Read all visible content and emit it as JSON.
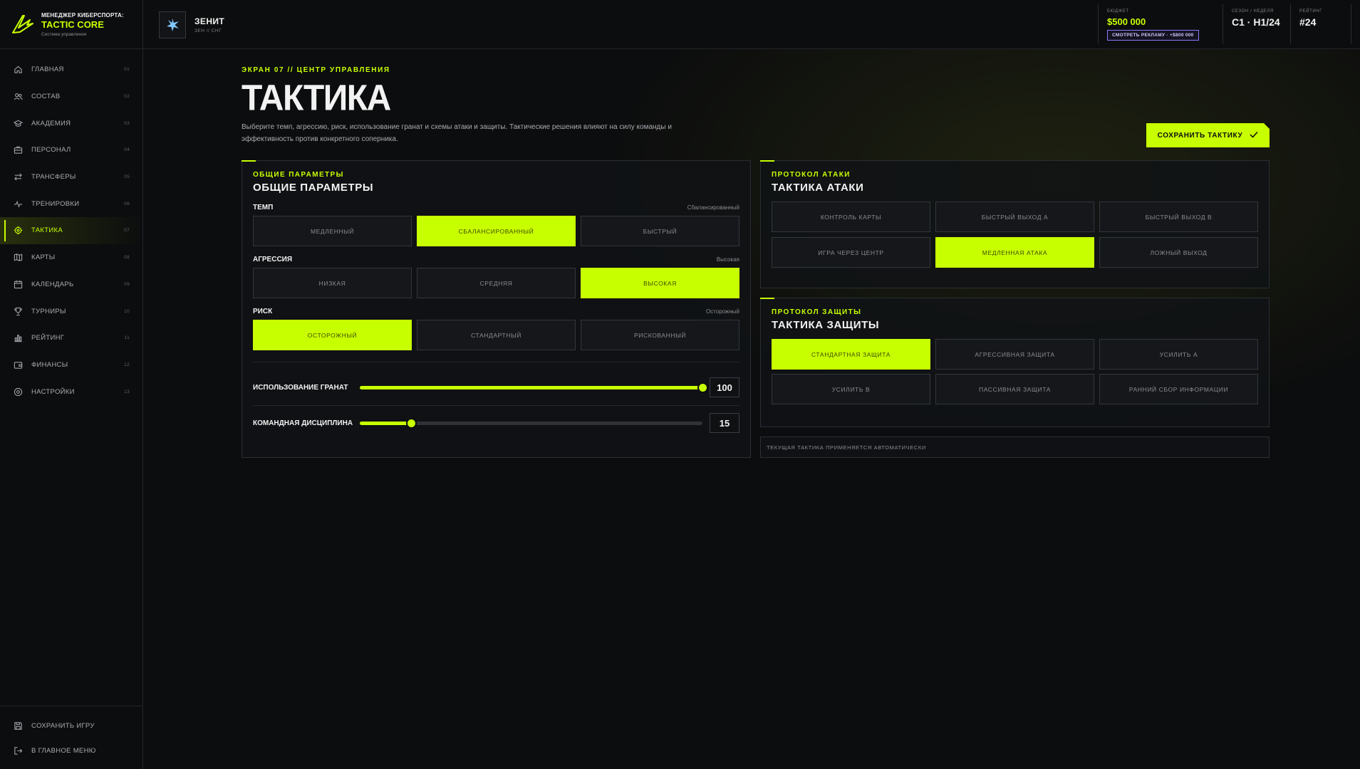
{
  "brand": {
    "pre": "МЕНЕДЖЕР КИБЕРСПОРТА:",
    "name": "TACTIC CORE",
    "sub": "Система управления"
  },
  "nav": [
    {
      "label": "ГЛАВНАЯ",
      "num": "01",
      "icon": "home-icon"
    },
    {
      "label": "СОСТАВ",
      "num": "02",
      "icon": "users-icon"
    },
    {
      "label": "АКАДЕМИЯ",
      "num": "03",
      "icon": "graduation-cap-icon"
    },
    {
      "label": "ПЕРСОНАЛ",
      "num": "04",
      "icon": "briefcase-icon"
    },
    {
      "label": "ТРАНСФЕРЫ",
      "num": "05",
      "icon": "swap-arrows-icon"
    },
    {
      "label": "ТРЕНИРОВКИ",
      "num": "06",
      "icon": "pulse-icon"
    },
    {
      "label": "ТАКТИКА",
      "num": "07",
      "icon": "crosshair-icon",
      "active": true
    },
    {
      "label": "КАРТЫ",
      "num": "08",
      "icon": "map-icon"
    },
    {
      "label": "КАЛЕНДАРЬ",
      "num": "09",
      "icon": "calendar-icon"
    },
    {
      "label": "ТУРНИРЫ",
      "num": "10",
      "icon": "trophy-icon"
    },
    {
      "label": "РЕЙТИНГ",
      "num": "11",
      "icon": "bar-chart-icon"
    },
    {
      "label": "ФИНАНСЫ",
      "num": "12",
      "icon": "wallet-icon"
    },
    {
      "label": "НАСТРОЙКИ",
      "num": "13",
      "icon": "settings-icon"
    }
  ],
  "nav_bottom": [
    {
      "label": "СОХРАНИТЬ ИГРУ",
      "icon": "save-icon"
    },
    {
      "label": "В ГЛАВНОЕ МЕНЮ",
      "icon": "logout-icon"
    }
  ],
  "team": {
    "name": "ЗЕНИТ",
    "sub": "ЗЕН // СНГ"
  },
  "stats": {
    "budget_label": "БЮДЖЕТ",
    "budget_value": "$500 000",
    "ad_button": "СМОТРЕТЬ РЕКЛАМУ · +$800 000",
    "season_label": "СЕЗОН / НЕДЕЛЯ",
    "season_value": "С1 · Н1/24",
    "rating_label": "РЕЙТИНГ",
    "rating_value": "#24"
  },
  "page": {
    "eyebrow": "ЭКРАН 07 // ЦЕНТР УПРАВЛЕНИЯ",
    "title": "ТАКТИКА",
    "desc": "Выберите темп, агрессию, риск, использование гранат и схемы атаки и защиты. Тактические решения влияют на силу команды и эффективность против конкретного соперника.",
    "save_button": "СОХРАНИТЬ ТАКТИКУ"
  },
  "general": {
    "eyebrow": "ОБЩИЕ ПАРАМЕТРЫ",
    "title": "ОБЩИЕ ПАРАМЕТРЫ",
    "tempo": {
      "label": "ТЕМП",
      "value": "Сбалансированный",
      "options": [
        "МЕДЛЕННЫЙ",
        "СБАЛАНСИРОВАННЫЙ",
        "БЫСТРЫЙ"
      ],
      "selected": 1
    },
    "aggression": {
      "label": "АГРЕССИЯ",
      "value": "Высокая",
      "options": [
        "НИЗКАЯ",
        "СРЕДНЯЯ",
        "ВЫСОКАЯ"
      ],
      "selected": 2
    },
    "risk": {
      "label": "РИСК",
      "value": "Осторожный",
      "options": [
        "ОСТОРОЖНЫЙ",
        "СТАНДАРТНЫЙ",
        "РИСКОВАННЫЙ"
      ],
      "selected": 0
    },
    "grenades": {
      "label": "ИСПОЛЬЗОВАНИЕ ГРАНАТ",
      "value": "100",
      "percent": 100
    },
    "discipline": {
      "label": "КОМАНДНАЯ ДИСЦИПЛИНА",
      "value": "15",
      "percent": 15
    }
  },
  "attack": {
    "eyebrow": "ПРОТОКОЛ АТАКИ",
    "title": "ТАКТИКА АТАКИ",
    "options": [
      "КОНТРОЛЬ КАРТЫ",
      "БЫСТРЫЙ ВЫХОД А",
      "БЫСТРЫЙ ВЫХОД B",
      "ИГРА ЧЕРЕЗ ЦЕНТР",
      "МЕДЛЕННАЯ АТАКА",
      "ЛОЖНЫЙ ВЫХОД"
    ],
    "selected": 4
  },
  "defense": {
    "eyebrow": "ПРОТОКОЛ ЗАЩИТЫ",
    "title": "ТАКТИКА ЗАЩИТЫ",
    "options": [
      "СТАНДАРТНАЯ ЗАЩИТА",
      "АГРЕССИВНАЯ ЗАЩИТА",
      "УСИЛИТЬ А",
      "УСИЛИТЬ B",
      "ПАССИВНАЯ ЗАЩИТА",
      "РАННИЙ СБОР ИНФОРМАЦИИ"
    ],
    "selected": 0
  },
  "hint": "ТЕКУЩАЯ ТАКТИКА ПРИМЕНЯЕТСЯ АВТОМАТИЧЕСКИ",
  "colors": {
    "accent": "#c8ff00",
    "bg": "#0c0d0e",
    "purple": "#8a7cff"
  }
}
